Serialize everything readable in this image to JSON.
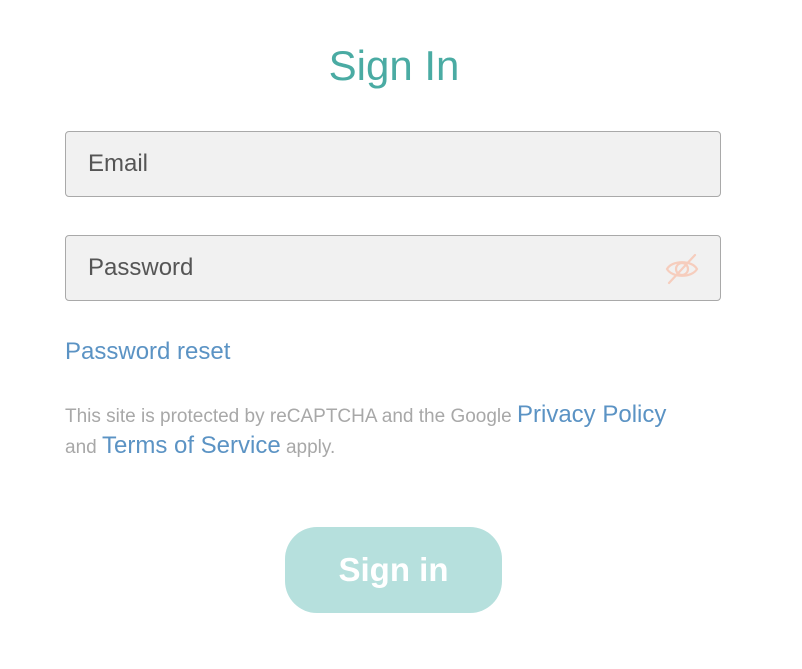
{
  "colors": {
    "title": "#4aaba3",
    "link": "#5b93c4",
    "muted_text": "#a8a8a8",
    "button_bg": "#b6e0dd",
    "button_text": "#ffffff",
    "eye_icon": "#f6cdbd"
  },
  "page": {
    "title": "Sign In"
  },
  "form": {
    "email_placeholder": "Email",
    "password_placeholder": "Password",
    "password_toggle_icon": "eye-slash-icon",
    "reset_link_label": "Password reset",
    "submit_label": "Sign in"
  },
  "recaptcha": {
    "text_before": "This site is protected by reCAPTCHA and the Google ",
    "privacy_link": "Privacy Policy",
    "text_middle": " and ",
    "terms_link": "Terms of Service",
    "text_after": " apply."
  }
}
